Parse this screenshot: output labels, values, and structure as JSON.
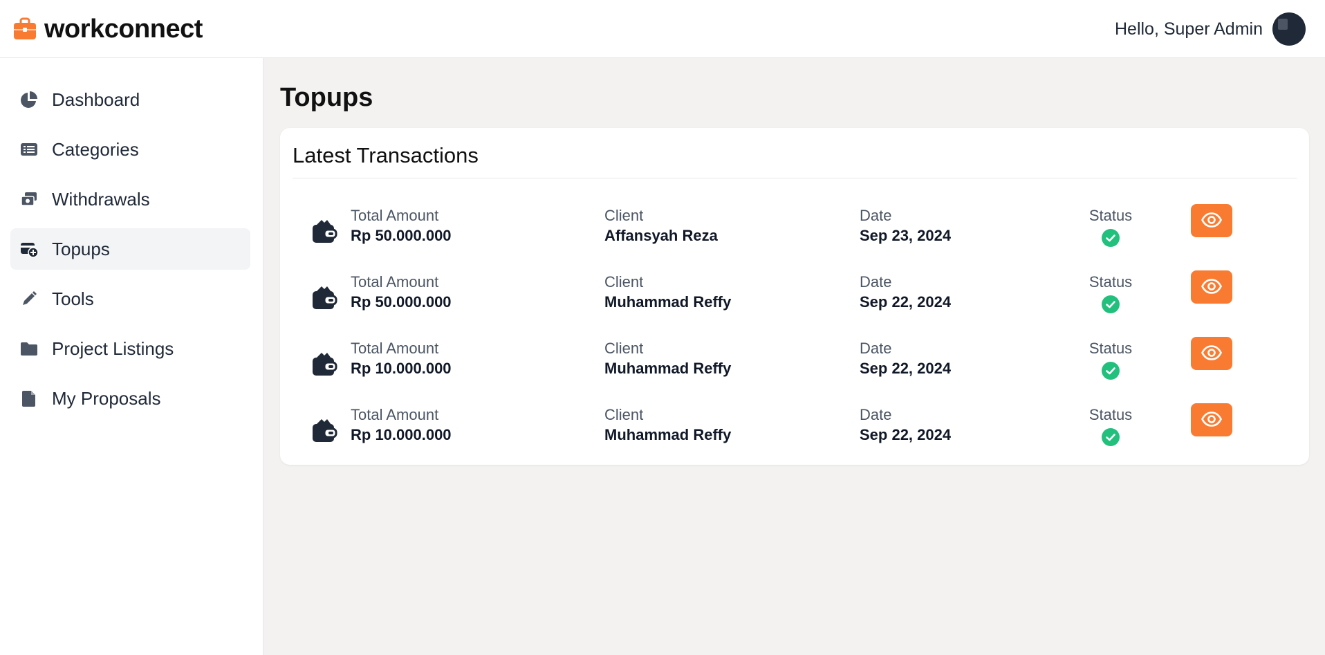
{
  "brand": {
    "name": "workconnect",
    "icon": "briefcase-icon",
    "color": "#f97b31"
  },
  "header": {
    "greeting": "Hello, Super Admin",
    "avatar_icon": "user-avatar"
  },
  "sidebar": {
    "items": [
      {
        "label": "Dashboard",
        "icon": "pie-chart-icon",
        "active": false
      },
      {
        "label": "Categories",
        "icon": "list-icon",
        "active": false
      },
      {
        "label": "Withdrawals",
        "icon": "money-icon",
        "active": false
      },
      {
        "label": "Topups",
        "icon": "card-plus-icon",
        "active": true
      },
      {
        "label": "Tools",
        "icon": "pen-icon",
        "active": false
      },
      {
        "label": "Project Listings",
        "icon": "folder-icon",
        "active": false
      },
      {
        "label": "My Proposals",
        "icon": "document-icon",
        "active": false
      }
    ]
  },
  "page": {
    "title": "Topups"
  },
  "transactions": {
    "title": "Latest Transactions",
    "labels": {
      "amount": "Total Amount",
      "client": "Client",
      "date": "Date",
      "status": "Status"
    },
    "rows": [
      {
        "amount": "Rp 50.000.000",
        "client": "Affansyah Reza",
        "date": "Sep 23, 2024",
        "status": "success"
      },
      {
        "amount": "Rp 50.000.000",
        "client": "Muhammad Reffy",
        "date": "Sep 22, 2024",
        "status": "success"
      },
      {
        "amount": "Rp 10.000.000",
        "client": "Muhammad Reffy",
        "date": "Sep 22, 2024",
        "status": "success"
      },
      {
        "amount": "Rp 10.000.000",
        "client": "Muhammad Reffy",
        "date": "Sep 22, 2024",
        "status": "success"
      }
    ]
  },
  "colors": {
    "accent": "#f97b31",
    "success": "#22c07d",
    "icon_gray": "#4b5563"
  }
}
